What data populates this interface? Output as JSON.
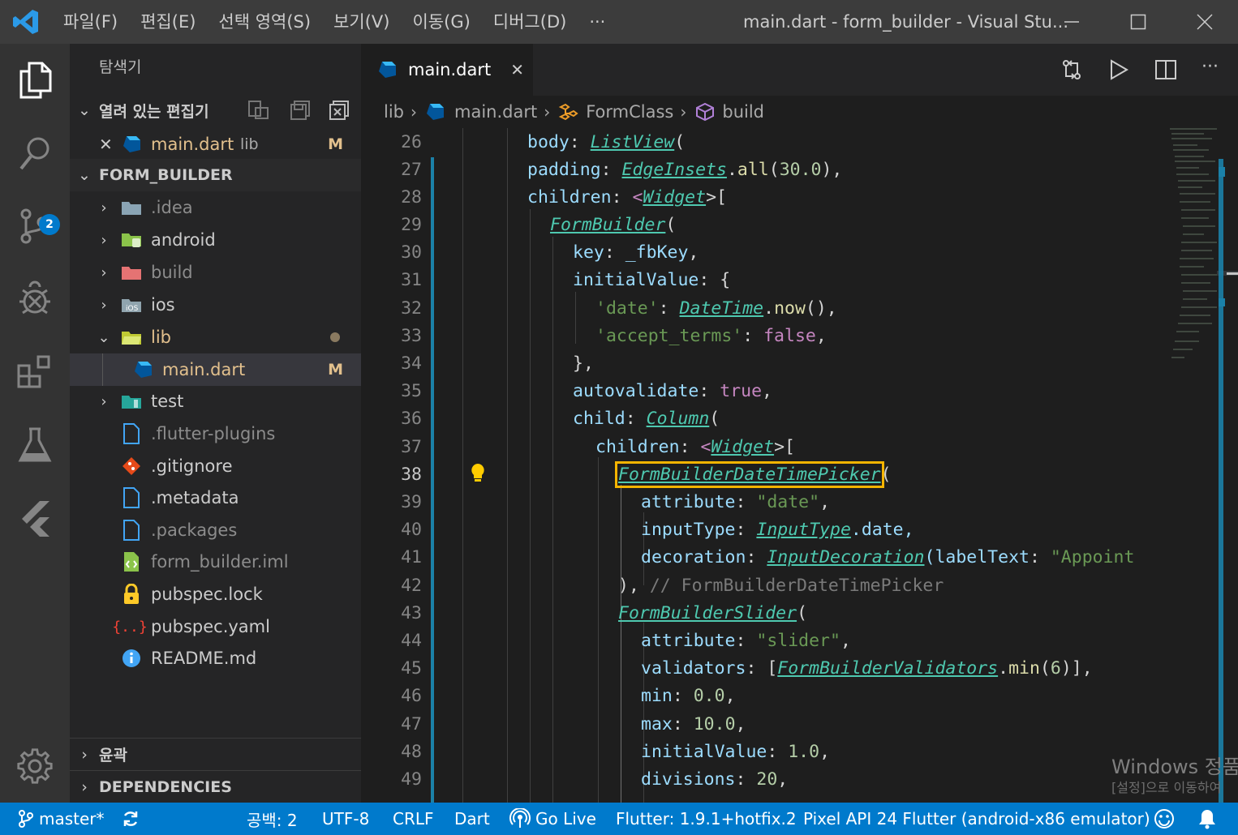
{
  "titlebar": {
    "menu": [
      "파일(F)",
      "편집(E)",
      "선택 영역(S)",
      "보기(V)",
      "이동(G)",
      "디버그(D)",
      "···"
    ],
    "window_title": "main.dart - form_builder - Visual Stu..."
  },
  "activity": {
    "scm_badge": "2"
  },
  "sidebar": {
    "title": "탐색기",
    "open_editors": {
      "header": "열려 있는 편집기",
      "item": {
        "name": "main.dart",
        "folder": "lib",
        "decoration": "M"
      }
    },
    "project": {
      "header": "FORM_BUILDER",
      "items": [
        {
          "label": ".idea",
          "dim": true
        },
        {
          "label": "android"
        },
        {
          "label": "build",
          "dim": true
        },
        {
          "label": "ios"
        },
        {
          "label": "lib",
          "modified_dot": true
        },
        {
          "label": "main.dart",
          "decoration": "M"
        },
        {
          "label": "test"
        },
        {
          "label": ".flutter-plugins",
          "dim": true
        },
        {
          "label": ".gitignore"
        },
        {
          "label": ".metadata"
        },
        {
          "label": ".packages",
          "dim": true
        },
        {
          "label": "form_builder.iml",
          "dim": true
        },
        {
          "label": "pubspec.lock"
        },
        {
          "label": "pubspec.yaml"
        },
        {
          "label": "README.md"
        }
      ]
    },
    "outline_header": "윤곽",
    "dependencies_header": "DEPENDENCIES"
  },
  "editor": {
    "tab_label": "main.dart",
    "breadcrumb": [
      "lib",
      "main.dart",
      "FormClass",
      "build"
    ],
    "line_numbers": [
      "26",
      "27",
      "28",
      "29",
      "30",
      "31",
      "32",
      "33",
      "34",
      "35",
      "36",
      "37",
      "38",
      "39",
      "40",
      "41",
      "42",
      "43",
      "44",
      "45",
      "46",
      "47",
      "48",
      "49"
    ],
    "current_line": "38",
    "code": {
      "l26": [
        "body",
        ": ",
        "ListView",
        "("
      ],
      "l27": [
        "padding",
        ": ",
        "EdgeInsets",
        ".",
        "all",
        "(",
        "30.0",
        "),"
      ],
      "l28": [
        "children",
        ": ",
        "<",
        "Widget",
        ">["
      ],
      "l29": [
        "FormBuilder",
        "("
      ],
      "l30": [
        "key",
        ": ",
        "_fbKey",
        ","
      ],
      "l31": [
        "initialValue",
        ": {"
      ],
      "l32": [
        "'date'",
        ": ",
        "DateTime",
        ".",
        "now",
        "(),"
      ],
      "l33": [
        "'accept_terms'",
        ": ",
        "false",
        ","
      ],
      "l34": [
        "},"
      ],
      "l35": [
        "autovalidate",
        ": ",
        "true",
        ","
      ],
      "l36": [
        "child",
        ": ",
        "Column",
        "("
      ],
      "l37": [
        "children",
        ": ",
        "<",
        "Widget",
        ">["
      ],
      "l38": [
        "FormBuilderDateTimePicker",
        "("
      ],
      "l39": [
        "attribute",
        ": ",
        "\"date\"",
        ","
      ],
      "l40": [
        "inputType",
        ": ",
        "InputType",
        ".date,"
      ],
      "l41": [
        "decoration",
        ": ",
        "InputDecoration",
        "(labelText",
        ": ",
        "\"Appoint"
      ],
      "l42": [
        "), ",
        "// FormBuilderDateTimePicker"
      ],
      "l43": [
        "FormBuilderSlider",
        "("
      ],
      "l44": [
        "attribute",
        ": ",
        "\"slider\"",
        ","
      ],
      "l45": [
        "validators",
        ": [",
        "FormBuilderValidators",
        ".",
        "min",
        "(",
        "6",
        ")],"
      ],
      "l46": [
        "min",
        ": ",
        "0.0",
        ","
      ],
      "l47": [
        "max",
        ": ",
        "10.0",
        ","
      ],
      "l48": [
        "initialValue",
        ": ",
        "1.0",
        ","
      ],
      "l49": [
        "divisions",
        ": ",
        "20",
        ","
      ]
    }
  },
  "statusbar": {
    "branch": "master*",
    "spaces": "공백: 2",
    "encoding": "UTF-8",
    "eol": "CRLF",
    "language": "Dart",
    "golive": "Go Live",
    "flutter": "Flutter: 1.9.1+hotfix.2",
    "device": "Pixel API 24 Flutter (android-x86 emulator)"
  },
  "watermark": {
    "line1": "Windows 정품",
    "line2": "[설정]으로 이동하여"
  },
  "colors": {
    "accent": "#007acc",
    "highlight_box": "#f5b400"
  }
}
